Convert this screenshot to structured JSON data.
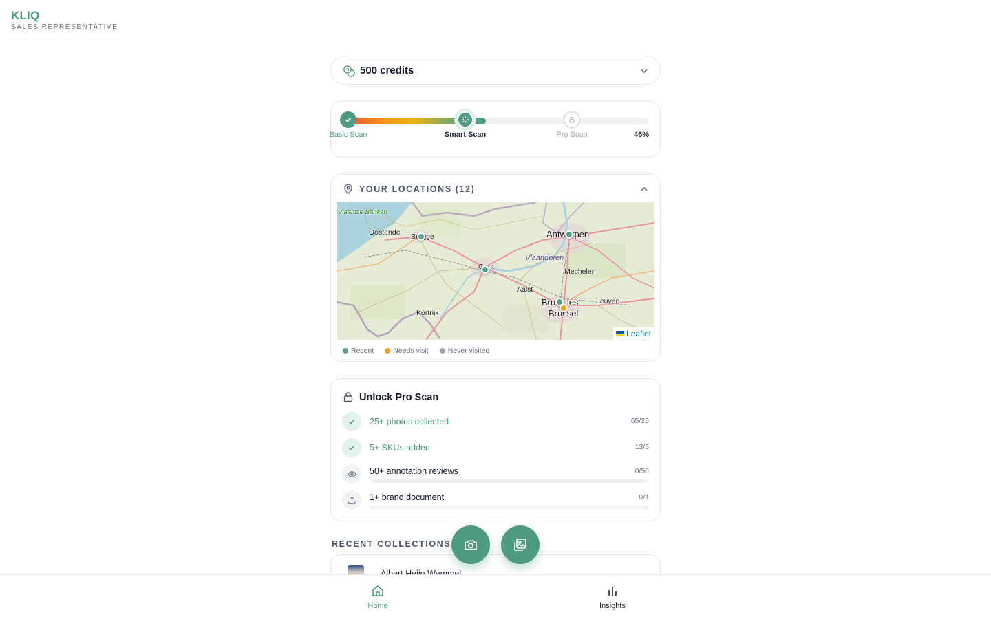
{
  "app": {
    "brand": "KLIQ",
    "role": "SALES REPRESENTATIVE"
  },
  "credits": {
    "label": "500 credits",
    "icon": "coins-icon"
  },
  "scan_progress": {
    "percent_label": "46%",
    "percent": 46,
    "steps": [
      {
        "label": "Basic Scan",
        "state": "done"
      },
      {
        "label": "Smart Scan",
        "state": "current"
      },
      {
        "label": "Pro Scan",
        "state": "locked"
      }
    ]
  },
  "locations": {
    "title": "YOUR LOCATIONS (12)",
    "map": {
      "place_labels": [
        "Oostende",
        "Brugge",
        "Antwerpen",
        "Vlaanderen",
        "Mechelen",
        "Aalst",
        "Bruxelles",
        "Brussel",
        "Leuven",
        "Kortrijk",
        "Gent",
        "Vlaamse Banken"
      ],
      "attribution": "Leaflet",
      "pins": [
        {
          "status": "recent"
        },
        {
          "status": "recent"
        },
        {
          "status": "recent"
        },
        {
          "status": "recent"
        },
        {
          "status": "needs_visit"
        }
      ]
    },
    "legend": [
      {
        "label": "Recent",
        "color": "#5a9e87"
      },
      {
        "label": "Needs visit",
        "color": "#f0a020"
      },
      {
        "label": "Never visited",
        "color": "#9ca3af"
      }
    ]
  },
  "unlock": {
    "title": "Unlock Pro Scan",
    "requirements": [
      {
        "label": "25+ photos collected",
        "count": "65/25",
        "done": true,
        "icon": "check-icon"
      },
      {
        "label": "5+ SKUs added",
        "count": "13/5",
        "done": true,
        "icon": "check-icon"
      },
      {
        "label": "50+ annotation reviews",
        "count": "0/50",
        "done": false,
        "progress": 0,
        "icon": "eye-icon"
      },
      {
        "label": "1+ brand document",
        "count": "0/1",
        "done": false,
        "progress": 0,
        "icon": "upload-icon"
      }
    ]
  },
  "recent": {
    "title": "RECENT COLLECTIONS",
    "items": [
      {
        "name": "Albert Heijn Wemmel"
      }
    ]
  },
  "fabs": [
    {
      "icon": "camera-icon"
    },
    {
      "icon": "gallery-icon"
    }
  ],
  "nav": [
    {
      "label": "Home",
      "icon": "home-icon",
      "active": true
    },
    {
      "label": "Insights",
      "icon": "bar-chart-icon",
      "active": false
    }
  ],
  "colors": {
    "accent": "#4e9a82",
    "warning": "#f0a020",
    "muted": "#9ca3af"
  }
}
